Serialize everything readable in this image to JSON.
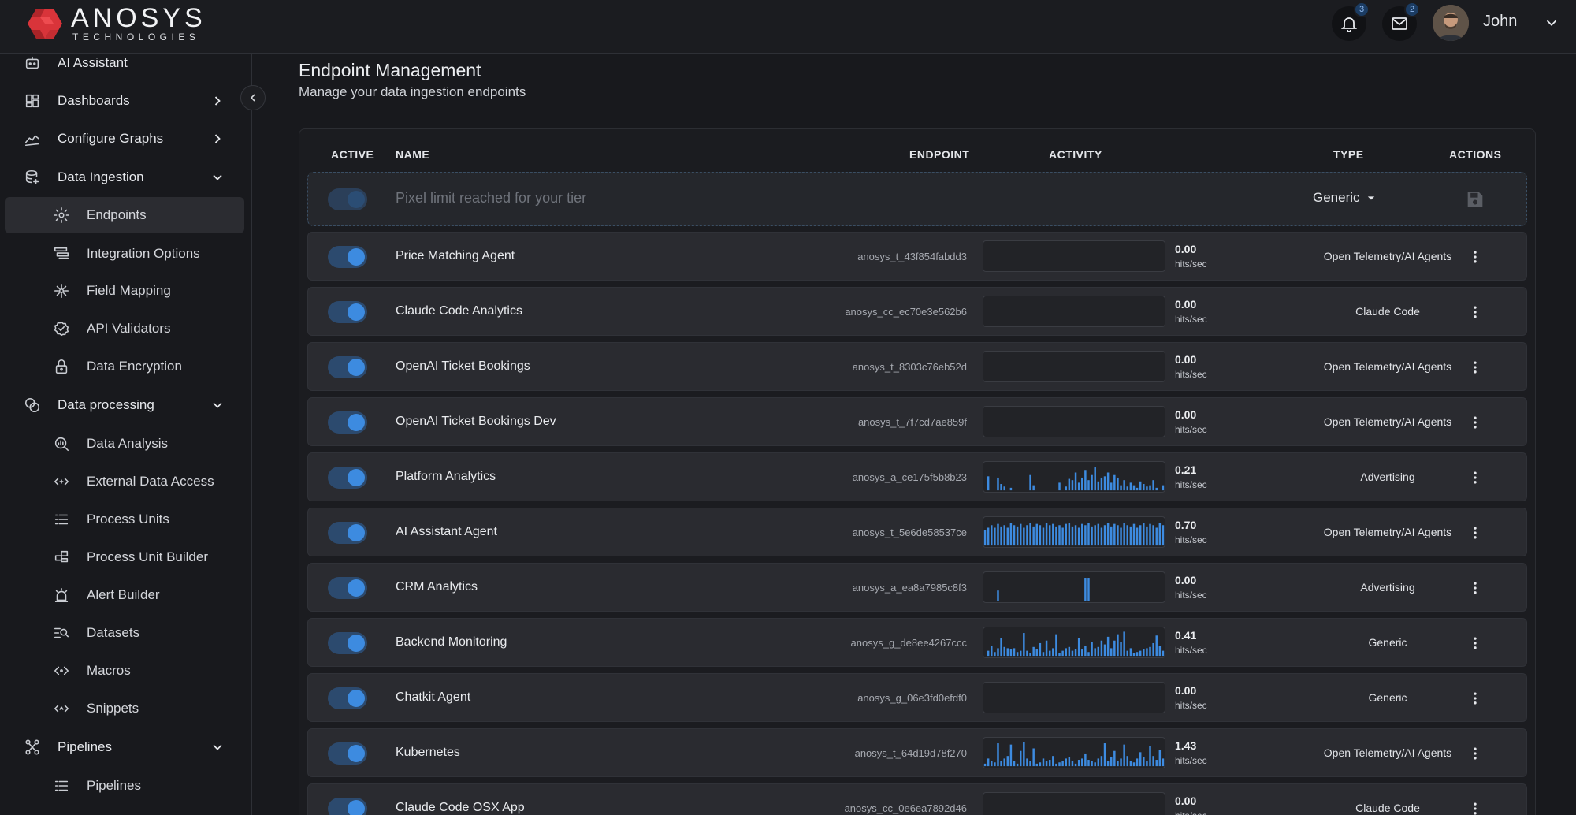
{
  "brand": {
    "name": "ANOSYS",
    "sub": "TECHNOLOGIES"
  },
  "header": {
    "notifications_count": "3",
    "messages_count": "2",
    "user_name": "John"
  },
  "sidebar": {
    "items": [
      {
        "label": "AI Assistant",
        "icon": "robot-icon",
        "level": "top"
      },
      {
        "label": "Dashboards",
        "icon": "dashboard-icon",
        "level": "top",
        "chevron": "right"
      },
      {
        "label": "Configure Graphs",
        "icon": "graph-icon",
        "level": "top",
        "chevron": "right"
      },
      {
        "label": "Data Ingestion",
        "icon": "database-icon",
        "level": "top",
        "chevron": "down"
      },
      {
        "label": "Endpoints",
        "icon": "gear-icon",
        "level": "sub",
        "active": true
      },
      {
        "label": "Integration Options",
        "icon": "layers-icon",
        "level": "sub"
      },
      {
        "label": "Field Mapping",
        "icon": "hub-icon",
        "level": "sub"
      },
      {
        "label": "API Validators",
        "icon": "verified-icon",
        "level": "sub"
      },
      {
        "label": "Data Encryption",
        "icon": "lock-icon",
        "level": "sub"
      },
      {
        "label": "Data processing",
        "icon": "circles-icon",
        "level": "top",
        "chevron": "down"
      },
      {
        "label": "Data Analysis",
        "icon": "analysis-icon",
        "level": "sub"
      },
      {
        "label": "External Data Access",
        "icon": "code-arrows-icon",
        "level": "sub"
      },
      {
        "label": "Process Units",
        "icon": "list-icon",
        "level": "sub"
      },
      {
        "label": "Process Unit Builder",
        "icon": "builder-icon",
        "level": "sub"
      },
      {
        "label": "Alert Builder",
        "icon": "alarm-icon",
        "level": "sub"
      },
      {
        "label": "Datasets",
        "icon": "dataset-search-icon",
        "level": "sub"
      },
      {
        "label": "Macros",
        "icon": "macro-icon",
        "level": "sub"
      },
      {
        "label": "Snippets",
        "icon": "snippet-icon",
        "level": "sub"
      },
      {
        "label": "Pipelines",
        "icon": "pipeline-icon",
        "level": "top",
        "chevron": "down"
      },
      {
        "label": "Pipelines",
        "icon": "list-icon",
        "level": "sub"
      }
    ]
  },
  "page": {
    "title": "Endpoint Management",
    "subtitle": "Manage your data ingestion endpoints"
  },
  "table": {
    "headers": {
      "active": "ACTIVE",
      "name": "NAME",
      "endpoint": "ENDPOINT",
      "activity": "ACTIVITY",
      "type": "TYPE",
      "actions": "ACTIONS"
    },
    "new_row": {
      "placeholder": "Pixel limit reached for your tier",
      "type": "Generic"
    },
    "rate_unit": "hits/sec",
    "rows": [
      {
        "name": "Price Matching Agent",
        "endpoint": "anosys_t_43f854fabdd3",
        "rate": "0.00",
        "type": "Open Telemetry/AI Agents",
        "activity": []
      },
      {
        "name": "Claude Code Analytics",
        "endpoint": "anosys_cc_ec70e3e562b6",
        "rate": "0.00",
        "type": "Claude Code",
        "activity": []
      },
      {
        "name": "OpenAI Ticket Bookings",
        "endpoint": "anosys_t_8303c76eb52d",
        "rate": "0.00",
        "type": "Open Telemetry/AI Agents",
        "activity": []
      },
      {
        "name": "OpenAI Ticket Bookings Dev",
        "endpoint": "anosys_t_7f7cd7ae859f",
        "rate": "0.00",
        "type": "Open Telemetry/AI Agents",
        "activity": []
      },
      {
        "name": "Platform Analytics",
        "endpoint": "anosys_a_ce175f5b8b23",
        "rate": "0.21",
        "type": "Advertising",
        "activity": [
          0,
          0.55,
          0,
          0,
          0.5,
          0.25,
          0.15,
          0,
          0.1,
          0,
          0,
          0,
          0,
          0,
          0.6,
          0.2,
          0,
          0,
          0,
          0,
          0,
          0,
          0,
          0.3,
          0,
          0.15,
          0.45,
          0.4,
          0.7,
          0.3,
          0.5,
          0.8,
          0.4,
          0.6,
          0.9,
          0.35,
          0.5,
          0.55,
          0.7,
          0.3,
          0.6,
          0.5,
          0.2,
          0.4,
          0.15,
          0.3,
          0.2,
          0.1,
          0.35,
          0.25,
          0.15,
          0.2,
          0.4,
          0.1,
          0,
          0.2
        ]
      },
      {
        "name": "AI Assistant Agent",
        "endpoint": "anosys_t_5e6de58537ce",
        "rate": "0.70",
        "type": "Open Telemetry/AI Agents",
        "activity": [
          0.6,
          0.7,
          0.8,
          0.7,
          0.85,
          0.75,
          0.8,
          0.7,
          0.9,
          0.8,
          0.75,
          0.85,
          0.7,
          0.8,
          0.9,
          0.75,
          0.85,
          0.8,
          0.7,
          0.9,
          0.8,
          0.85,
          0.75,
          0.8,
          0.7,
          0.85,
          0.9,
          0.75,
          0.8,
          0.7,
          0.85,
          0.8,
          0.9,
          0.75,
          0.8,
          0.85,
          0.7,
          0.8,
          0.9,
          0.75,
          0.85,
          0.8,
          0.7,
          0.9,
          0.8,
          0.75,
          0.85,
          0.7,
          0.8,
          0.9,
          0.75,
          0.85,
          0.8,
          0.7,
          0.9,
          0.8
        ]
      },
      {
        "name": "CRM Analytics",
        "endpoint": "anosys_a_ea8a7985c8f3",
        "rate": "0.00",
        "type": "Advertising",
        "activity": [
          0,
          0,
          0,
          0,
          0.4,
          0,
          0,
          0,
          0,
          0,
          0,
          0,
          0,
          0,
          0,
          0,
          0,
          0,
          0,
          0,
          0,
          0,
          0,
          0,
          0,
          0,
          0,
          0,
          0,
          0,
          0,
          0.9,
          0.9,
          0,
          0,
          0,
          0,
          0,
          0,
          0,
          0,
          0,
          0,
          0,
          0,
          0,
          0,
          0,
          0,
          0,
          0,
          0,
          0,
          0,
          0,
          0
        ]
      },
      {
        "name": "Backend Monitoring",
        "endpoint": "anosys_g_de8ee4267ccc",
        "rate": "0.41",
        "type": "Generic",
        "activity": [
          0,
          0.2,
          0.4,
          0.15,
          0.3,
          0.7,
          0.35,
          0.3,
          0.25,
          0.3,
          0.15,
          0.2,
          0.9,
          0.2,
          0.1,
          0.35,
          0.25,
          0.5,
          0.15,
          0.6,
          0.2,
          0.3,
          0.85,
          0.1,
          0.2,
          0.3,
          0.35,
          0.2,
          0.25,
          0.7,
          0.25,
          0.4,
          0.15,
          0.55,
          0.3,
          0.35,
          0.6,
          0.45,
          0.75,
          0.3,
          0.6,
          0.85,
          0.55,
          0.95,
          0.2,
          0.3,
          0.1,
          0.15,
          0.2,
          0.25,
          0.3,
          0.35,
          0.5,
          0.8,
          0.4,
          0.2
        ]
      },
      {
        "name": "Chatkit Agent",
        "endpoint": "anosys_g_06e3fd0efdf0",
        "rate": "0.00",
        "type": "Generic",
        "activity": []
      },
      {
        "name": "Kubernetes",
        "endpoint": "anosys_t_64d19d78f270",
        "rate": "1.43",
        "type": "Open Telemetry/AI Agents",
        "activity": [
          0.1,
          0.3,
          0.2,
          0.15,
          0.9,
          0.2,
          0.3,
          0.4,
          0.85,
          0.2,
          0.1,
          0.6,
          0.95,
          0.3,
          0.2,
          0.7,
          0.1,
          0.15,
          0.3,
          0.2,
          0.25,
          0.4,
          0.1,
          0.15,
          0.2,
          0.3,
          0.35,
          0.2,
          0.1,
          0.25,
          0.3,
          0.5,
          0.25,
          0.2,
          0.15,
          0.3,
          0.4,
          0.9,
          0.2,
          0.35,
          0.6,
          0.2,
          0.3,
          0.85,
          0.4,
          0.2,
          0.15,
          0.3,
          0.55,
          0.35,
          0.2,
          0.8,
          0.4,
          0.25,
          0.65,
          0.3
        ]
      },
      {
        "name": "Claude Code OSX App",
        "endpoint": "anosys_cc_0e6ea7892d46",
        "rate": "0.00",
        "type": "Claude Code",
        "activity": []
      }
    ]
  },
  "colors": {
    "accent": "#3d8be0",
    "logo": "#d9343a"
  }
}
